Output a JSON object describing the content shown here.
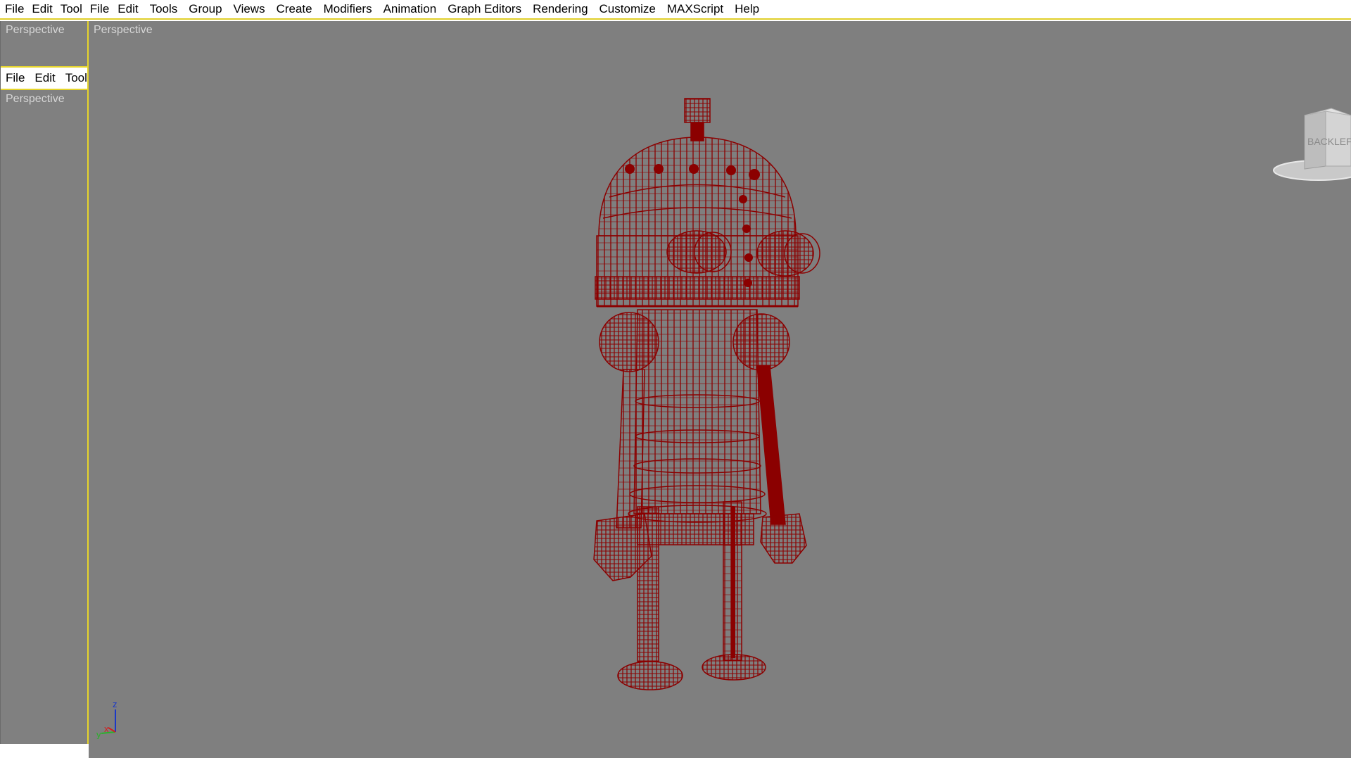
{
  "menubar": {
    "items": [
      "File",
      "Edit",
      "Tool",
      "File",
      "Edit",
      "Tools",
      "Group",
      "Views",
      "Create",
      "Modifiers",
      "Animation",
      "Graph Editors",
      "Rendering",
      "Customize",
      "MAXScript",
      "Help"
    ]
  },
  "left_panel": {
    "top_viewport_label": "Perspective",
    "mini_menu": [
      "File",
      "Edit",
      "Tool"
    ],
    "bottom_viewport_label": "Perspective"
  },
  "main_viewport": {
    "label": "Perspective",
    "wire_color": "#8b0000",
    "background": "#7f7f7f"
  },
  "axis": {
    "z": "z",
    "y": "y",
    "x": "x"
  },
  "viewcube": {
    "face_left": "BACK",
    "face_right": "LEFT"
  },
  "icons": [
    "viewcube-icon",
    "axis-tripod-icon"
  ]
}
